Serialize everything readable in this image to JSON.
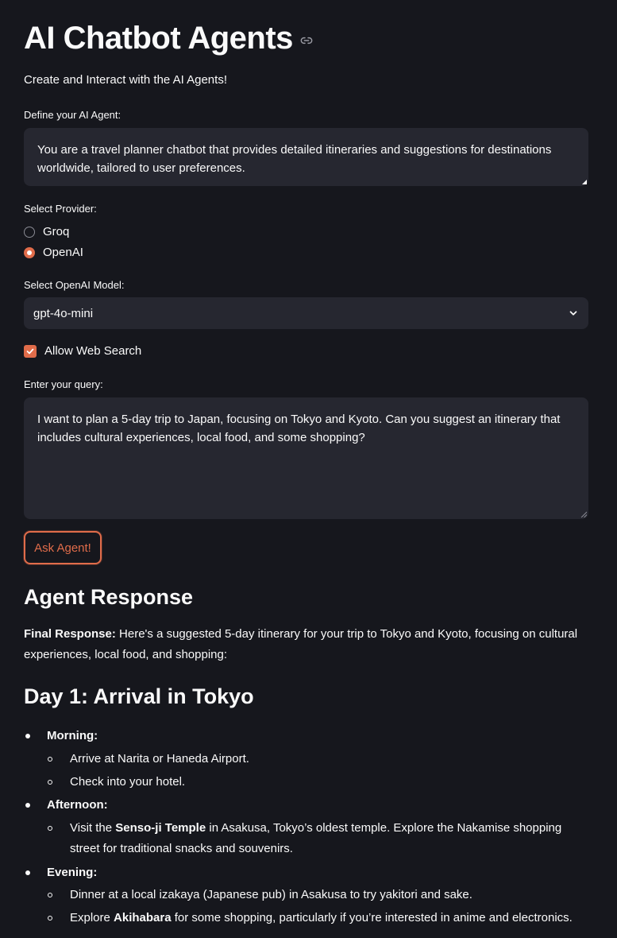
{
  "header": {
    "title": "AI Chatbot Agents",
    "subtitle": "Create and Interact with the AI Agents!"
  },
  "define_agent": {
    "label": "Define your AI Agent:",
    "value": "You are a travel planner chatbot that provides detailed itineraries and suggestions for destinations worldwide, tailored to user preferences."
  },
  "provider": {
    "label": "Select Provider:",
    "options": [
      "Groq",
      "OpenAI"
    ],
    "selected": "OpenAI"
  },
  "model": {
    "label": "Select OpenAI Model:",
    "value": "gpt-4o-mini"
  },
  "web_search": {
    "label": "Allow Web Search",
    "checked": true
  },
  "query": {
    "label": "Enter your query:",
    "value": "I want to plan a 5-day trip to Japan, focusing on Tokyo and Kyoto. Can you suggest an itinerary that includes cultural experiences, local food, and some shopping?"
  },
  "ask_button": {
    "label": "Ask Agent!"
  },
  "response": {
    "heading": "Agent Response",
    "final_label": "Final Response:",
    "final_text": " Here's a suggested 5-day itinerary for your trip to Tokyo and Kyoto, focusing on cultural experiences, local food, and shopping:",
    "day1_heading": "Day 1: Arrival in Tokyo",
    "sections": [
      {
        "title": "Morning:",
        "items": [
          {
            "pre": "Arrive at Narita or Haneda Airport.",
            "bold": "",
            "post": ""
          },
          {
            "pre": "Check into your hotel.",
            "bold": "",
            "post": ""
          }
        ]
      },
      {
        "title": "Afternoon:",
        "items": [
          {
            "pre": "Visit the ",
            "bold": "Senso-ji Temple",
            "post": " in Asakusa, Tokyo’s oldest temple. Explore the Nakamise shopping street for traditional snacks and souvenirs."
          }
        ]
      },
      {
        "title": "Evening:",
        "items": [
          {
            "pre": "Dinner at a local izakaya (Japanese pub) in Asakusa to try yakitori and sake.",
            "bold": "",
            "post": ""
          },
          {
            "pre": "Explore ",
            "bold": "Akihabara",
            "post": " for some shopping, particularly if you’re interested in anime and electronics."
          }
        ]
      }
    ]
  },
  "colors": {
    "background": "#16171d",
    "surface": "#262730",
    "accent": "#e06c4a",
    "text": "#fafafa"
  }
}
